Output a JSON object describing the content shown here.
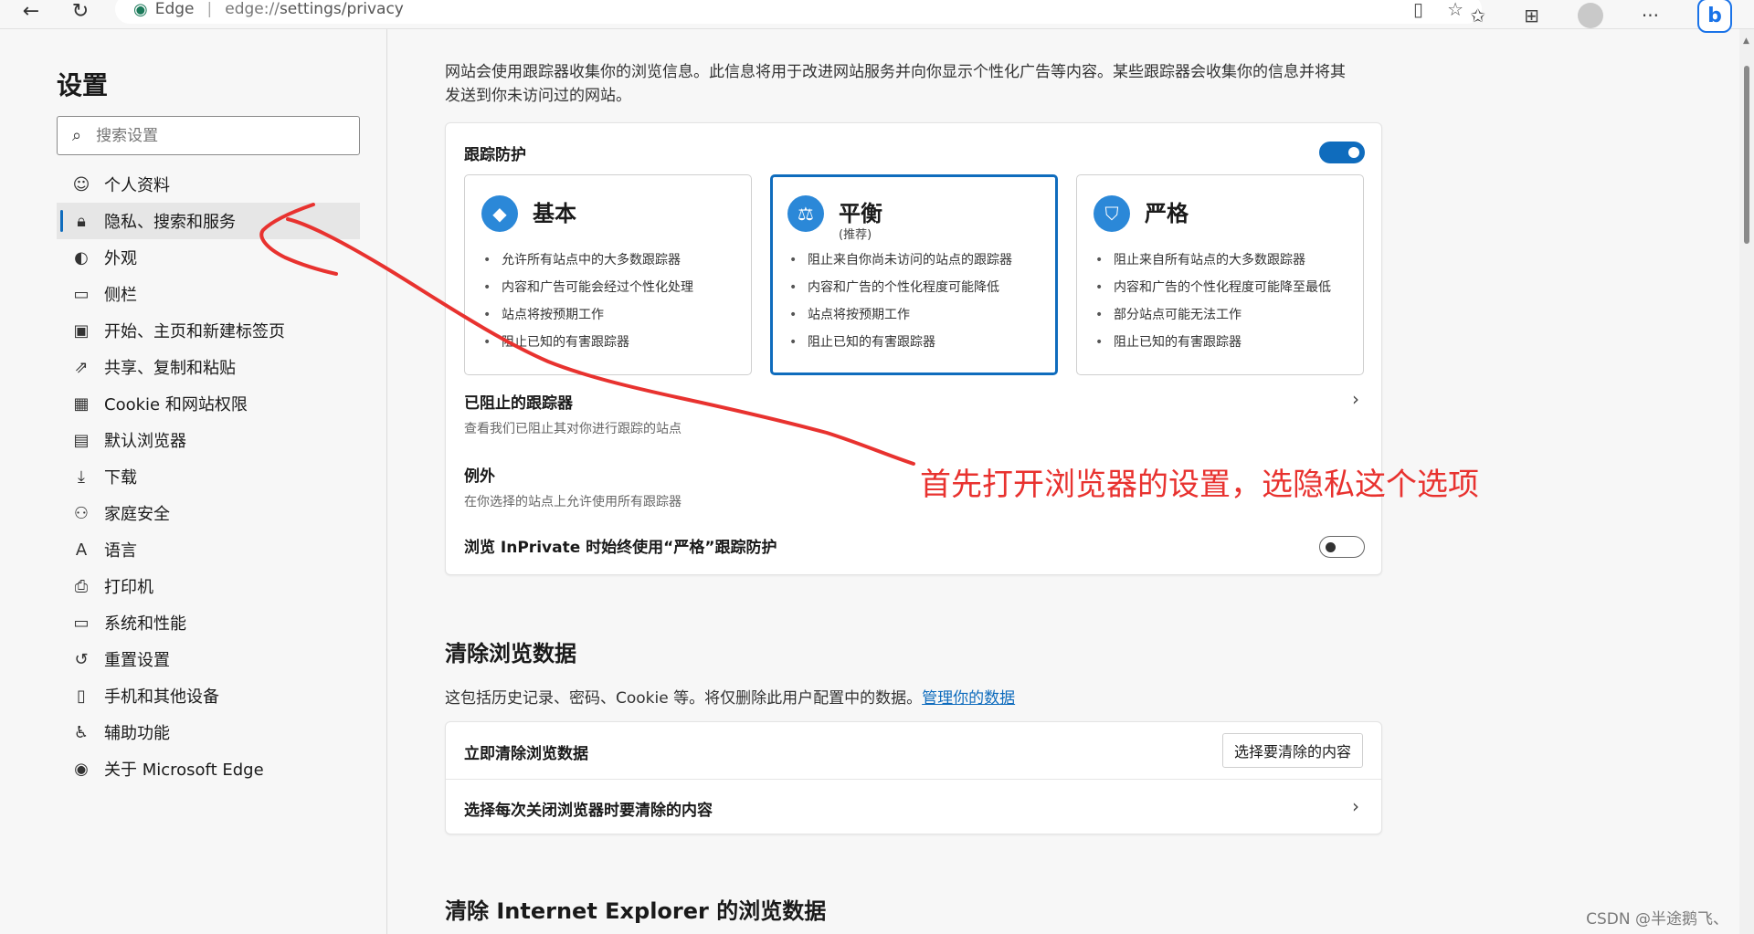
{
  "browser": {
    "brand": "Edge",
    "url_scheme": "edge://",
    "url_path": "settings/privacy"
  },
  "sidebar": {
    "title": "设置",
    "search_placeholder": "搜索设置",
    "items": [
      {
        "label": "个人资料",
        "icon": "profile-icon"
      },
      {
        "label": "隐私、搜索和服务",
        "icon": "lock-icon"
      },
      {
        "label": "外观",
        "icon": "palette-icon"
      },
      {
        "label": "侧栏",
        "icon": "sidebar-icon"
      },
      {
        "label": "开始、主页和新建标签页",
        "icon": "home-icon"
      },
      {
        "label": "共享、复制和粘贴",
        "icon": "share-icon"
      },
      {
        "label": "Cookie 和网站权限",
        "icon": "cookie-icon"
      },
      {
        "label": "默认浏览器",
        "icon": "browser-icon"
      },
      {
        "label": "下载",
        "icon": "download-icon"
      },
      {
        "label": "家庭安全",
        "icon": "family-icon"
      },
      {
        "label": "语言",
        "icon": "language-icon"
      },
      {
        "label": "打印机",
        "icon": "printer-icon"
      },
      {
        "label": "系统和性能",
        "icon": "laptop-icon"
      },
      {
        "label": "重置设置",
        "icon": "reset-icon"
      },
      {
        "label": "手机和其他设备",
        "icon": "phone-icon"
      },
      {
        "label": "辅助功能",
        "icon": "accessibility-icon"
      },
      {
        "label": "关于 Microsoft Edge",
        "icon": "edge-icon"
      }
    ]
  },
  "tracking": {
    "intro_line1": "网站会使用跟踪器收集你的浏览信息。此信息将用于改进网站服务并向你显示个性化广告等内容。某些跟踪器会收集你的信息并将其",
    "intro_line2": "发送到你未访问过的网站。",
    "card_title": "跟踪防护",
    "enabled": true,
    "options": [
      {
        "name": "基本",
        "recommended": "",
        "icon": "basic-shield-icon",
        "selected": false,
        "bullets": [
          "允许所有站点中的大多数跟踪器",
          "内容和广告可能会经过个性化处理",
          "站点将按预期工作",
          "阻止已知的有害跟踪器"
        ]
      },
      {
        "name": "平衡",
        "recommended": "(推荐)",
        "icon": "balance-scale-icon",
        "selected": true,
        "bullets": [
          "阻止来自你尚未访问的站点的跟踪器",
          "内容和广告的个性化程度可能降低",
          "站点将按预期工作",
          "阻止已知的有害跟踪器"
        ]
      },
      {
        "name": "严格",
        "recommended": "",
        "icon": "strict-shield-icon",
        "selected": false,
        "bullets": [
          "阻止来自所有站点的大多数跟踪器",
          "内容和广告的个性化程度可能降至最低",
          "部分站点可能无法工作",
          "阻止已知的有害跟踪器"
        ]
      }
    ],
    "blocked_title": "已阻止的跟踪器",
    "blocked_sub": "查看我们已阻止其对你进行跟踪的站点",
    "exceptions_title": "例外",
    "exceptions_sub": "在你选择的站点上允许使用所有跟踪器",
    "inprivate_label": "浏览 InPrivate 时始终使用“严格”跟踪防护",
    "inprivate_enabled": false
  },
  "clear_data": {
    "title": "清除浏览数据",
    "desc": "这包括历史记录、密码、Cookie 等。将仅删除此用户配置中的数据。",
    "manage_link": "管理你的数据",
    "clear_now_label": "立即清除浏览数据",
    "choose_button": "选择要清除的内容",
    "on_close_label": "选择每次关闭浏览器时要清除的内容"
  },
  "ie_section_title": "清除 Internet Explorer 的浏览数据",
  "annotation": {
    "text": "首先打开浏览器的设置，选隐私这个选项",
    "color": "#e8322f"
  },
  "watermark": "CSDN @半途鹅飞、"
}
